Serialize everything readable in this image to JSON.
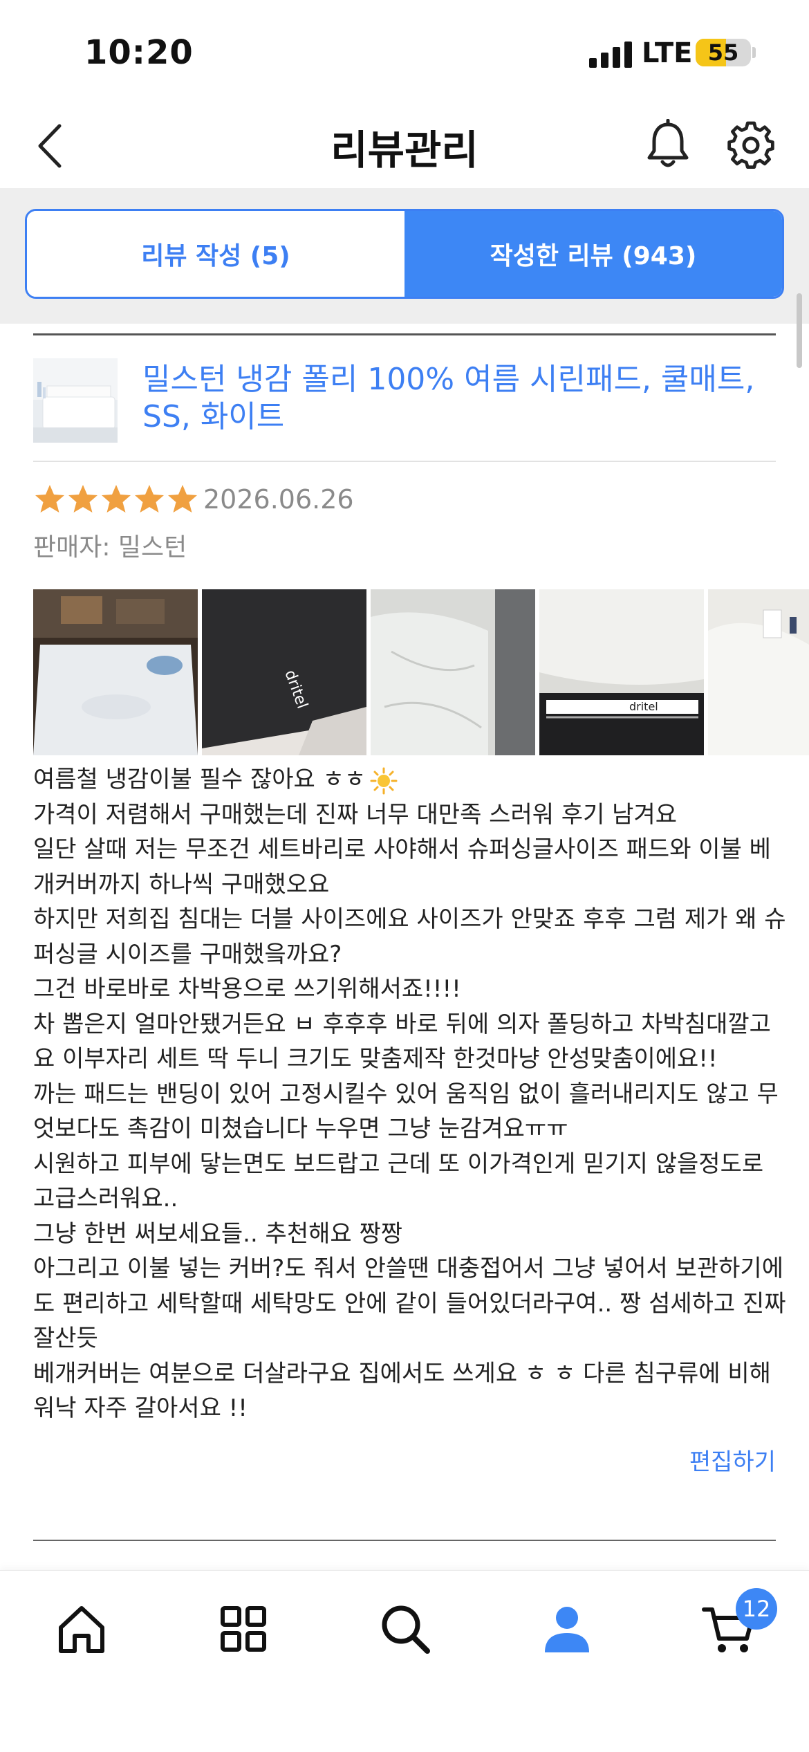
{
  "status_bar": {
    "time": "10:20",
    "network": "LTE",
    "battery": "55",
    "battery_level": 0.55
  },
  "header": {
    "title": "리뷰관리",
    "icons": [
      "back-chevron-icon",
      "bell-icon",
      "gear-icon"
    ]
  },
  "tabs": [
    {
      "label": "리뷰 작성 (5)",
      "active": false
    },
    {
      "label": "작성한 리뷰 (943)",
      "active": true
    }
  ],
  "review": {
    "product_name_line1": "밀스턴 냉감 폴리 100% 여름 시린패드, 쿨매트,",
    "product_name_line2": "SS, 화이트",
    "rating": 5,
    "date": "2026.06.26",
    "seller": "판매자: 밀스턴",
    "photo_count_visible": 5,
    "body_lines": [
      "여름철 냉감이불 필수 잖아요 ㅎㅎ",
      "가격이 저렴해서 구매했는데 진짜 너무 대만족 스러워 후기 남겨요",
      "일단 살때 저는 무조건 세트바리로 사야해서 슈퍼싱글사이즈 패드와 이불 베",
      "개커버까지 하나씩 구매했오요",
      "하지만 저희집 침대는 더블 사이즈에요 사이즈가 안맞죠 후후 그럼 제가 왜 슈",
      "퍼싱글 시이즈를 구매했읔까요?",
      "그건 바로바로 차박용으로 쓰기위해서죠!!!!",
      "차 뽑은지 얼마안됐거든요 ㅂ 후후후 바로 뒤에 의자 폴딩하고 차박침대깔고",
      "요 이부자리 세트 딱 두니 크기도 맞춤제작 한것마냥 안성맞춤이에요!!",
      "까는 패드는 밴딩이 있어 고정시킬수 있어 움직임 없이 흘러내리지도 않고  무",
      "엇보다도 촉감이 미쳤습니다 누우면 그냥 눈감겨요ㅠㅠ",
      "시원하고 피부에 닿는면도 보드랍고 근데 또 이가격인게 믿기지 않을정도로",
      "고급스러워요..",
      "그냥 한번 써보세요들.. 추천해요 짱짱",
      "아그리고 이불 넣는 커버?도 줘서 안쓸땐 대충접어서 그냥 넣어서 보관하기에",
      "도 편리하고 세탁할때 세탁망도 안에 같이 들어있더라구여.. 짱 섬세하고 진짜",
      "잘산듯",
      "베개커버는 여분으로 더살라구요 집에서도 쓰게요 ㅎ ㅎ 다른 침구류에 비해",
      "워낙 자주 갈아서요 !!"
    ],
    "edit_label": "편집하기"
  },
  "bottom_nav": {
    "items": [
      "home-icon",
      "categories-icon",
      "search-icon",
      "profile-icon",
      "cart-icon"
    ],
    "active": "profile-icon",
    "cart_badge": "12"
  },
  "colors": {
    "accent": "#3d7ff3",
    "star": "#f0a040",
    "muted": "#8a8a8a"
  }
}
